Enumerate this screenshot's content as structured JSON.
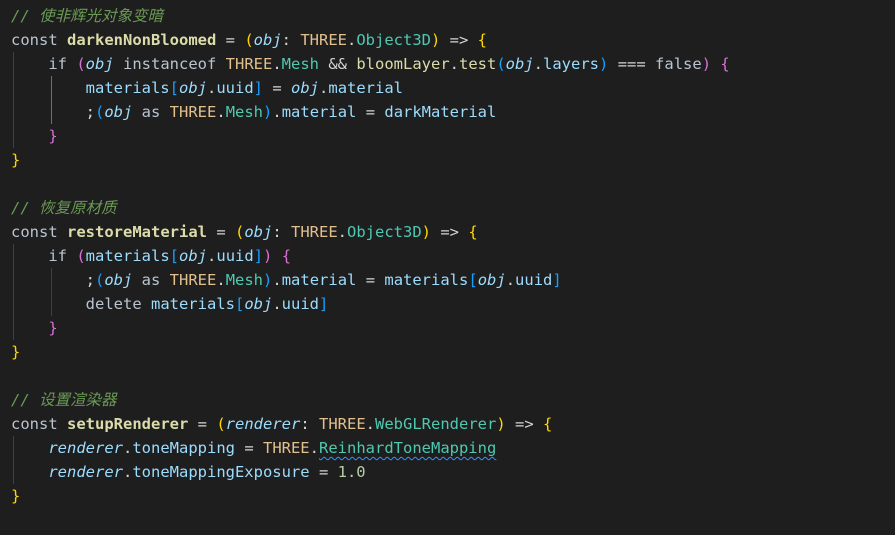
{
  "editor": {
    "language": "typescript",
    "theme": "dark",
    "background": "#1e1e1e",
    "colors": {
      "comment": "#6a9955",
      "keyword": "#b8c4d0",
      "function": "#dcdcaa",
      "parameter": "#9cdcfe",
      "type": "#4ec9b0",
      "number": "#b5cea8",
      "bracket_level_1": "#ffd700",
      "bracket_level_2": "#da70d6",
      "bracket_level_3": "#179fff"
    },
    "lines": [
      {
        "tokens": [
          {
            "t": "comment",
            "v": "// 使非辉光对象变暗"
          }
        ]
      },
      {
        "tokens": [
          {
            "t": "kw",
            "v": "const "
          },
          {
            "t": "fn",
            "v": "darkenNonBloomed"
          },
          {
            "t": "plain",
            "v": " = "
          },
          {
            "t": "b1",
            "v": "("
          },
          {
            "t": "param",
            "v": "obj"
          },
          {
            "t": "plain",
            "v": ": "
          },
          {
            "t": "class",
            "v": "THREE"
          },
          {
            "t": "plain",
            "v": "."
          },
          {
            "t": "type",
            "v": "Object3D"
          },
          {
            "t": "b1",
            "v": ")"
          },
          {
            "t": "plain",
            "v": " => "
          },
          {
            "t": "b1",
            "v": "{"
          }
        ]
      },
      {
        "tokens": [
          {
            "t": "plain",
            "v": "    "
          },
          {
            "t": "kw",
            "v": "if "
          },
          {
            "t": "b2",
            "v": "("
          },
          {
            "t": "param",
            "v": "obj"
          },
          {
            "t": "kw",
            "v": " instanceof "
          },
          {
            "t": "class",
            "v": "THREE"
          },
          {
            "t": "plain",
            "v": "."
          },
          {
            "t": "type",
            "v": "Mesh"
          },
          {
            "t": "plain",
            "v": " && "
          },
          {
            "t": "method",
            "v": "bloomLayer"
          },
          {
            "t": "plain",
            "v": "."
          },
          {
            "t": "method",
            "v": "test"
          },
          {
            "t": "b3",
            "v": "("
          },
          {
            "t": "param",
            "v": "obj"
          },
          {
            "t": "plain",
            "v": "."
          },
          {
            "t": "prop",
            "v": "layers"
          },
          {
            "t": "b3",
            "v": ")"
          },
          {
            "t": "plain",
            "v": " === "
          },
          {
            "t": "kw",
            "v": "false"
          },
          {
            "t": "b2",
            "v": ")"
          },
          {
            "t": "plain",
            "v": " "
          },
          {
            "t": "b2",
            "v": "{"
          }
        ]
      },
      {
        "tokens": [
          {
            "t": "plain",
            "v": "        "
          },
          {
            "t": "prop",
            "v": "materials"
          },
          {
            "t": "b3",
            "v": "["
          },
          {
            "t": "param",
            "v": "obj"
          },
          {
            "t": "plain",
            "v": "."
          },
          {
            "t": "prop",
            "v": "uuid"
          },
          {
            "t": "b3",
            "v": "]"
          },
          {
            "t": "plain",
            "v": " = "
          },
          {
            "t": "param",
            "v": "obj"
          },
          {
            "t": "plain",
            "v": "."
          },
          {
            "t": "prop",
            "v": "material"
          }
        ]
      },
      {
        "tokens": [
          {
            "t": "plain",
            "v": "        ;"
          },
          {
            "t": "b3",
            "v": "("
          },
          {
            "t": "param",
            "v": "obj"
          },
          {
            "t": "kw",
            "v": " as "
          },
          {
            "t": "class",
            "v": "THREE"
          },
          {
            "t": "plain",
            "v": "."
          },
          {
            "t": "type",
            "v": "Mesh"
          },
          {
            "t": "b3",
            "v": ")"
          },
          {
            "t": "plain",
            "v": "."
          },
          {
            "t": "prop",
            "v": "material"
          },
          {
            "t": "plain",
            "v": " = "
          },
          {
            "t": "prop",
            "v": "darkMaterial"
          }
        ]
      },
      {
        "tokens": [
          {
            "t": "plain",
            "v": "    "
          },
          {
            "t": "b2",
            "v": "}"
          }
        ]
      },
      {
        "tokens": [
          {
            "t": "b1",
            "v": "}"
          }
        ]
      },
      {
        "tokens": []
      },
      {
        "tokens": [
          {
            "t": "comment",
            "v": "// 恢复原材质"
          }
        ]
      },
      {
        "tokens": [
          {
            "t": "kw",
            "v": "const "
          },
          {
            "t": "fn",
            "v": "restoreMaterial"
          },
          {
            "t": "plain",
            "v": " = "
          },
          {
            "t": "b1",
            "v": "("
          },
          {
            "t": "param",
            "v": "obj"
          },
          {
            "t": "plain",
            "v": ": "
          },
          {
            "t": "class",
            "v": "THREE"
          },
          {
            "t": "plain",
            "v": "."
          },
          {
            "t": "type",
            "v": "Object3D"
          },
          {
            "t": "b1",
            "v": ")"
          },
          {
            "t": "plain",
            "v": " => "
          },
          {
            "t": "b1",
            "v": "{"
          }
        ]
      },
      {
        "tokens": [
          {
            "t": "plain",
            "v": "    "
          },
          {
            "t": "kw",
            "v": "if "
          },
          {
            "t": "b2",
            "v": "("
          },
          {
            "t": "prop",
            "v": "materials"
          },
          {
            "t": "b3",
            "v": "["
          },
          {
            "t": "param",
            "v": "obj"
          },
          {
            "t": "plain",
            "v": "."
          },
          {
            "t": "prop",
            "v": "uuid"
          },
          {
            "t": "b3",
            "v": "]"
          },
          {
            "t": "b2",
            "v": ")"
          },
          {
            "t": "plain",
            "v": " "
          },
          {
            "t": "b2",
            "v": "{"
          }
        ]
      },
      {
        "tokens": [
          {
            "t": "plain",
            "v": "        ;"
          },
          {
            "t": "b3",
            "v": "("
          },
          {
            "t": "param",
            "v": "obj"
          },
          {
            "t": "kw",
            "v": " as "
          },
          {
            "t": "class",
            "v": "THREE"
          },
          {
            "t": "plain",
            "v": "."
          },
          {
            "t": "type",
            "v": "Mesh"
          },
          {
            "t": "b3",
            "v": ")"
          },
          {
            "t": "plain",
            "v": "."
          },
          {
            "t": "prop",
            "v": "material"
          },
          {
            "t": "plain",
            "v": " = "
          },
          {
            "t": "prop",
            "v": "materials"
          },
          {
            "t": "b3",
            "v": "["
          },
          {
            "t": "param",
            "v": "obj"
          },
          {
            "t": "plain",
            "v": "."
          },
          {
            "t": "prop",
            "v": "uuid"
          },
          {
            "t": "b3",
            "v": "]"
          }
        ]
      },
      {
        "tokens": [
          {
            "t": "plain",
            "v": "        "
          },
          {
            "t": "kw",
            "v": "delete "
          },
          {
            "t": "prop",
            "v": "materials"
          },
          {
            "t": "b3",
            "v": "["
          },
          {
            "t": "param",
            "v": "obj"
          },
          {
            "t": "plain",
            "v": "."
          },
          {
            "t": "prop",
            "v": "uuid"
          },
          {
            "t": "b3",
            "v": "]"
          }
        ]
      },
      {
        "tokens": [
          {
            "t": "plain",
            "v": "    "
          },
          {
            "t": "b2",
            "v": "}"
          }
        ]
      },
      {
        "tokens": [
          {
            "t": "b1",
            "v": "}"
          }
        ]
      },
      {
        "tokens": []
      },
      {
        "tokens": [
          {
            "t": "comment",
            "v": "// 设置渲染器"
          }
        ]
      },
      {
        "tokens": [
          {
            "t": "kw",
            "v": "const "
          },
          {
            "t": "fn",
            "v": "setupRenderer"
          },
          {
            "t": "plain",
            "v": " = "
          },
          {
            "t": "b1",
            "v": "("
          },
          {
            "t": "param",
            "v": "renderer"
          },
          {
            "t": "plain",
            "v": ": "
          },
          {
            "t": "class",
            "v": "THREE"
          },
          {
            "t": "plain",
            "v": "."
          },
          {
            "t": "type",
            "v": "WebGLRenderer"
          },
          {
            "t": "b1",
            "v": ")"
          },
          {
            "t": "plain",
            "v": " => "
          },
          {
            "t": "b1",
            "v": "{"
          }
        ]
      },
      {
        "tokens": [
          {
            "t": "plain",
            "v": "    "
          },
          {
            "t": "param",
            "v": "renderer"
          },
          {
            "t": "plain",
            "v": "."
          },
          {
            "t": "prop",
            "v": "toneMapping"
          },
          {
            "t": "plain",
            "v": " = "
          },
          {
            "t": "class",
            "v": "THREE"
          },
          {
            "t": "plain",
            "v": "."
          },
          {
            "t": "squig",
            "v": "ReinhardToneMapping"
          }
        ]
      },
      {
        "tokens": [
          {
            "t": "plain",
            "v": "    "
          },
          {
            "t": "param",
            "v": "renderer"
          },
          {
            "t": "plain",
            "v": "."
          },
          {
            "t": "prop",
            "v": "toneMappingExposure"
          },
          {
            "t": "plain",
            "v": " = "
          },
          {
            "t": "num",
            "v": "1.0"
          }
        ]
      },
      {
        "tokens": [
          {
            "t": "b1",
            "v": "}"
          }
        ]
      }
    ],
    "guides": [
      {
        "col": 0,
        "from": 2,
        "to": 5,
        "active": false
      },
      {
        "col": 1,
        "from": 3,
        "to": 4,
        "active": true
      },
      {
        "col": 0,
        "from": 10,
        "to": 13,
        "active": false
      },
      {
        "col": 1,
        "from": 11,
        "to": 12,
        "active": false
      },
      {
        "col": 0,
        "from": 18,
        "to": 19,
        "active": false
      }
    ]
  }
}
